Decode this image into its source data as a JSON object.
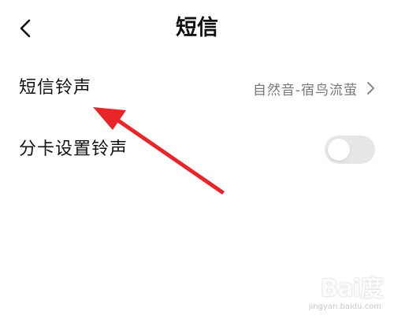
{
  "header": {
    "title": "短信",
    "back_icon": "chevron-left-icon"
  },
  "settings": {
    "ringtone": {
      "label": "短信铃声",
      "value": "自然音-宿鸟流萤",
      "icon": "chevron-right-icon"
    },
    "dual_sim_ringtone": {
      "label": "分卡设置铃声",
      "enabled": false
    }
  },
  "annotation": {
    "arrow_color": "#e8262a"
  },
  "watermark": {
    "brand": "Bai度",
    "url": "jingyan.baidu.com"
  },
  "colors": {
    "background": "#ffffff",
    "text_primary": "#111111",
    "text_secondary": "#777777",
    "toggle_off": "#e6e6e6"
  }
}
